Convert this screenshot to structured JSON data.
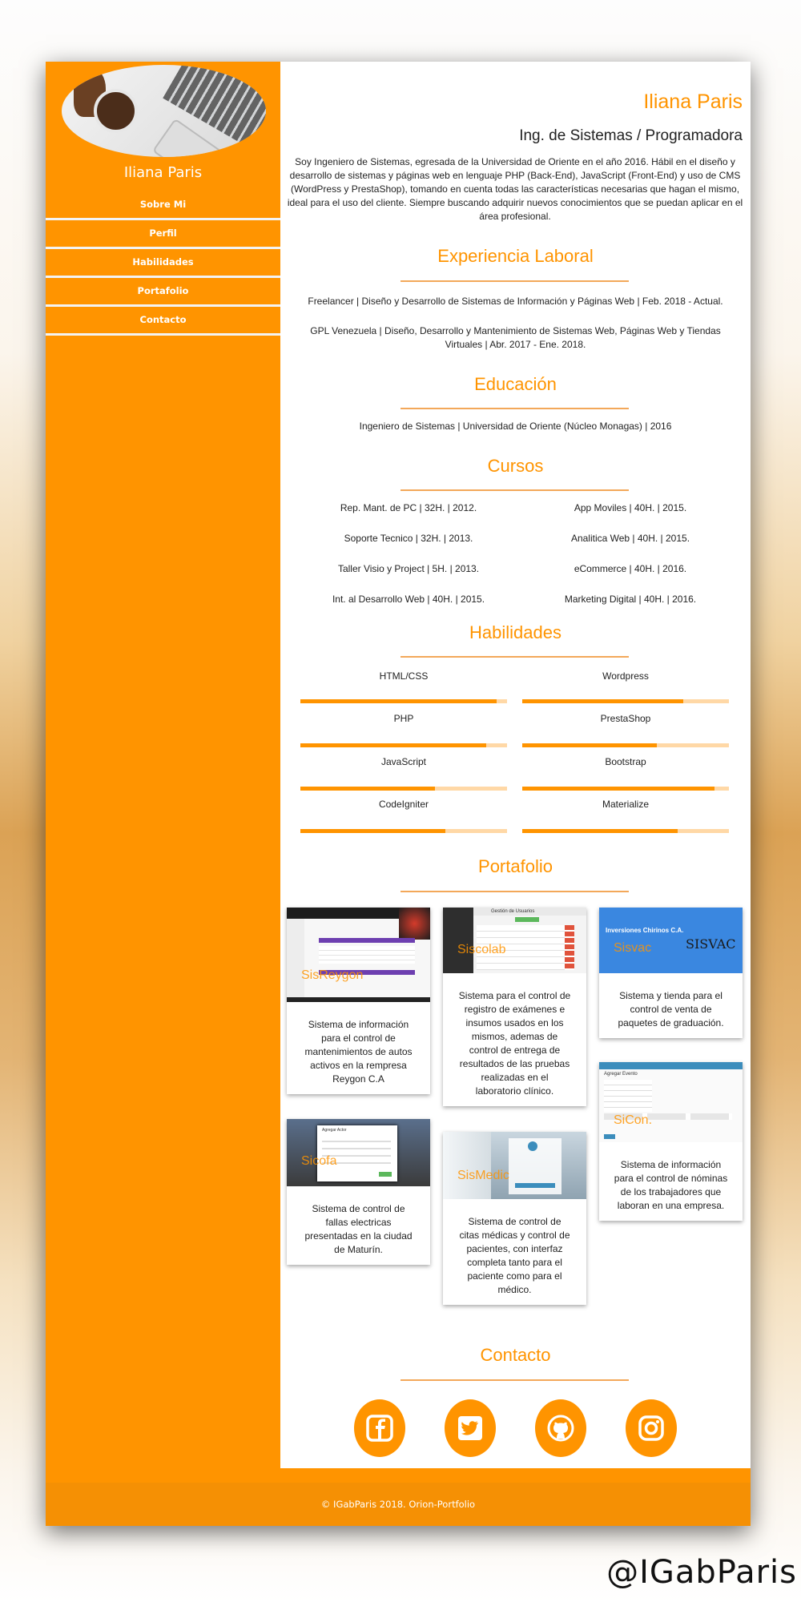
{
  "sidebar": {
    "name": "Iliana Paris",
    "menu": [
      "Sobre Mi",
      "Perfil",
      "Habilidades",
      "Portafolio",
      "Contacto"
    ]
  },
  "header": {
    "name": "Iliana Paris",
    "role": "Ing. de Sistemas / Programadora",
    "about": "Soy Ingeniero de Sistemas, egresada de la Universidad de Oriente en el año 2016. Hábil en el diseño y desarrollo de sistemas y páginas web en lenguaje PHP (Back-End), JavaScript (Front-End) y uso de CMS (WordPress y PrestaShop), tomando en cuenta todas las características necesarias que hagan el mismo, ideal para el uso del cliente. Siempre buscando adquirir nuevos conocimientos que se puedan aplicar en el área profesional."
  },
  "experience": {
    "title": "Experiencia Laboral",
    "items": [
      "Freelancer | Diseño y Desarrollo de Sistemas de Información y Páginas Web | Feb. 2018 - Actual.",
      "GPL Venezuela | Diseño, Desarrollo y Mantenimiento de Sistemas Web, Páginas Web y Tiendas Virtuales | Abr. 2017 - Ene. 2018."
    ]
  },
  "education": {
    "title": "Educación",
    "items": [
      "Ingeniero de Sistemas | Universidad de Oriente (Núcleo Monagas) | 2016"
    ]
  },
  "courses": {
    "title": "Cursos",
    "left": [
      "Rep. Mant. de PC | 32H. | 2012.",
      "Soporte Tecnico | 32H. | 2013.",
      "Taller Visio y Project | 5H. | 2013.",
      "Int. al Desarrollo Web | 40H. | 2015."
    ],
    "right": [
      "App Moviles | 40H. | 2015.",
      "Analitica Web | 40H. | 2015.",
      "eCommerce | 40H. | 2016.",
      "Marketing Digital | 40H. | 2016."
    ]
  },
  "skills": {
    "title": "Habilidades",
    "left": [
      {
        "name": "HTML/CSS",
        "level": 0.95
      },
      {
        "name": "PHP",
        "level": 0.9
      },
      {
        "name": "JavaScript",
        "level": 0.65
      },
      {
        "name": "CodeIgniter",
        "level": 0.7
      }
    ],
    "right": [
      {
        "name": "Wordpress",
        "level": 0.78
      },
      {
        "name": "PrestaShop",
        "level": 0.65
      },
      {
        "name": "Bootstrap",
        "level": 0.93
      },
      {
        "name": "Materialize",
        "level": 0.75
      }
    ]
  },
  "portfolio": {
    "title": "Portafolio",
    "projects": [
      {
        "title": "SisReygon",
        "desc": "Sistema de información para el control de mantenimientos de autos activos en la rempresa Reygon C.A"
      },
      {
        "title": "Siscolab",
        "desc": "Sistema para el control de registro de exámenes e insumos usados en los mismos, ademas de control de entrega de resultados de las pruebas realizadas en el laboratorio clínico."
      },
      {
        "title": "Sisvac",
        "desc": "Sistema y tienda para el control de venta de paquetes de graduación."
      },
      {
        "title": "SiCon.",
        "desc": "Sistema de información para el control de nóminas de los trabajadores que laboran en una empresa."
      },
      {
        "title": "Sicofa",
        "desc": "Sistema de control de fallas electricas presentadas en la ciudad de Maturín."
      },
      {
        "title": "SisMedic",
        "desc": "Sistema de control de citas médicas y control de pacientes, con interfaz completa tanto para el paciente como para el médico."
      }
    ],
    "thumb_texts": {
      "sisvac_company": "Inversiones Chirinos C.A.",
      "sisvac_logo": "SISVAC",
      "siscolab_header": "Gestión de Usuarios",
      "sicon_header": "Agregar Evento",
      "sicofa_header": "Agregar Actor"
    }
  },
  "contact": {
    "title": "Contacto",
    "icons": [
      "facebook-icon",
      "twitter-icon",
      "github-icon",
      "instagram-icon"
    ]
  },
  "footer": {
    "text": "© IGabParis 2018. Orion-Portfolio"
  },
  "watermark": "@IGabParis",
  "colors": {
    "accent": "#ff9400",
    "footer": "#f59004"
  }
}
